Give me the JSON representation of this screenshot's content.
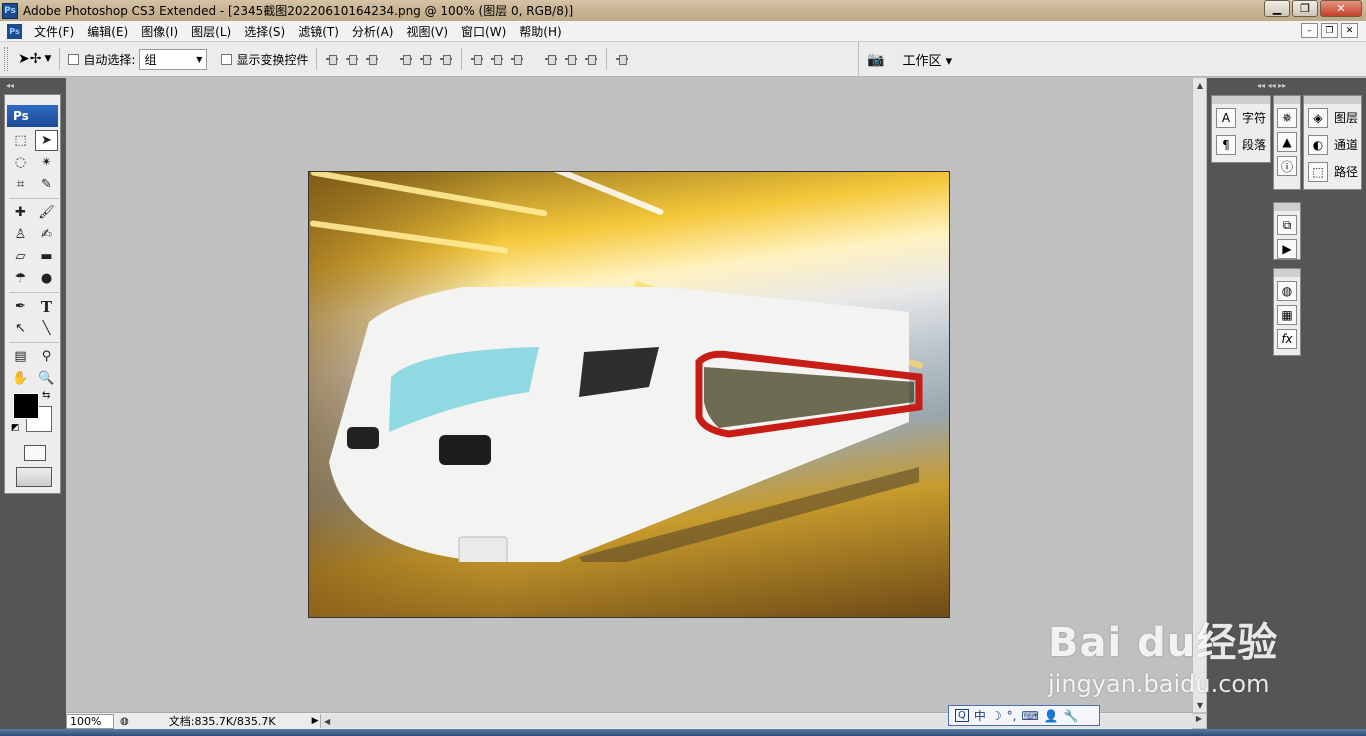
{
  "window": {
    "app_icon": "Ps",
    "title": "Adobe Photoshop CS3 Extended - [2345截图20220610164234.png @ 100% (图层 0, RGB/8)]",
    "minimize": "▁",
    "restore": "❐",
    "close": "✕"
  },
  "menu": {
    "app_icon": "Ps",
    "items": [
      "文件(F)",
      "编辑(E)",
      "图像(I)",
      "图层(L)",
      "选择(S)",
      "滤镜(T)",
      "分析(A)",
      "视图(V)",
      "窗口(W)",
      "帮助(H)"
    ],
    "doc_min": "–",
    "doc_restore": "❐",
    "doc_close": "✕"
  },
  "options": {
    "auto_select_label": "自动选择:",
    "auto_select_value": "组",
    "show_transform_label": "显示变换控件",
    "workspace_label": "工作区 ▾"
  },
  "toolbox": {
    "header": "Ps"
  },
  "status": {
    "zoom": "100%",
    "doc_size": "文档:835.7K/835.7K"
  },
  "panels": {
    "col1": [
      {
        "icon": "A",
        "label": "字符"
      },
      {
        "icon": "¶",
        "label": "段落"
      }
    ],
    "col3": [
      {
        "icon": "◈",
        "label": "图层"
      },
      {
        "icon": "◐",
        "label": "通道"
      },
      {
        "icon": "⬚",
        "label": "路径"
      }
    ]
  },
  "ime": {
    "items": [
      "中",
      "☽",
      "°,",
      "⌨",
      "👤",
      "🔧"
    ]
  },
  "watermark": {
    "main": "Bai du经验",
    "sub": "jingyan.baidu.com"
  }
}
